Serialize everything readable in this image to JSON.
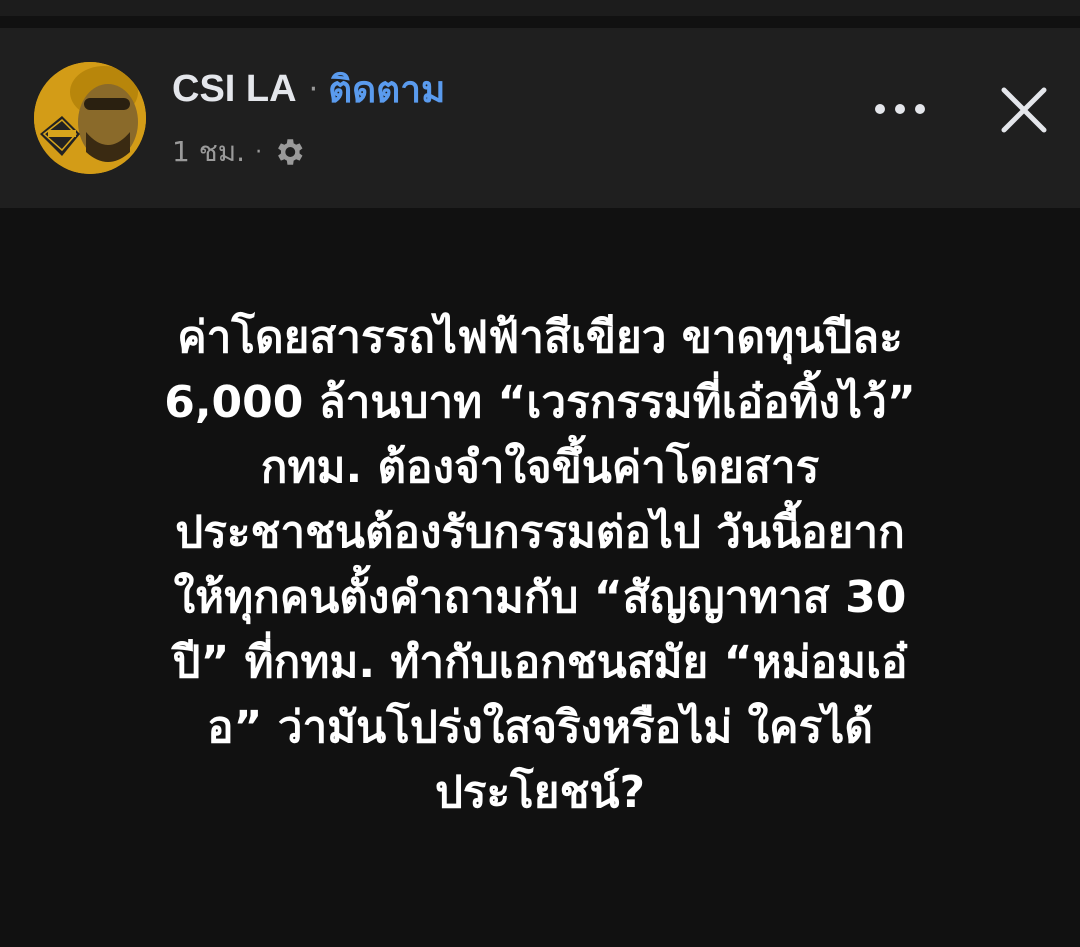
{
  "header": {
    "author_name": "CSI LA",
    "separator": "·",
    "follow_label": "ติดตาม",
    "timestamp": "1 ชม.",
    "meta_separator": "·",
    "avatar_icon": "profile-avatar",
    "privacy_icon": "gear-icon",
    "more_icon": "more-horizontal-icon",
    "close_icon": "close-icon"
  },
  "post": {
    "lines": [
      "ค่าโดยสารรถไฟฟ้าสีเขียว ขาดทุนปีละ",
      "6,000 ล้านบาท  “เวรกรรมที่เอ๋อทิ้งไว้”",
      "กทม. ต้องจำใจขึ้นค่าโดยสาร",
      "ประชาชนต้องรับกรรมต่อไป วันนี้อยาก",
      "ให้ทุกคนตั้งคำถามกับ “สัญญาทาส 30",
      "ปี” ที่กทม. ทำกับเอกชนสมัย “หม่อมเอ๋",
      "อ” ว่ามันโปร่งใสจริงหรือไม่ ใครได้",
      "ประโยชน์?"
    ]
  },
  "colors": {
    "background": "#111111",
    "header_background": "#1f1f1f",
    "follow_link": "#5a9bee",
    "name_text": "#e4e6eb",
    "meta_text": "#9a9a9a",
    "body_text": "#ffffff"
  }
}
